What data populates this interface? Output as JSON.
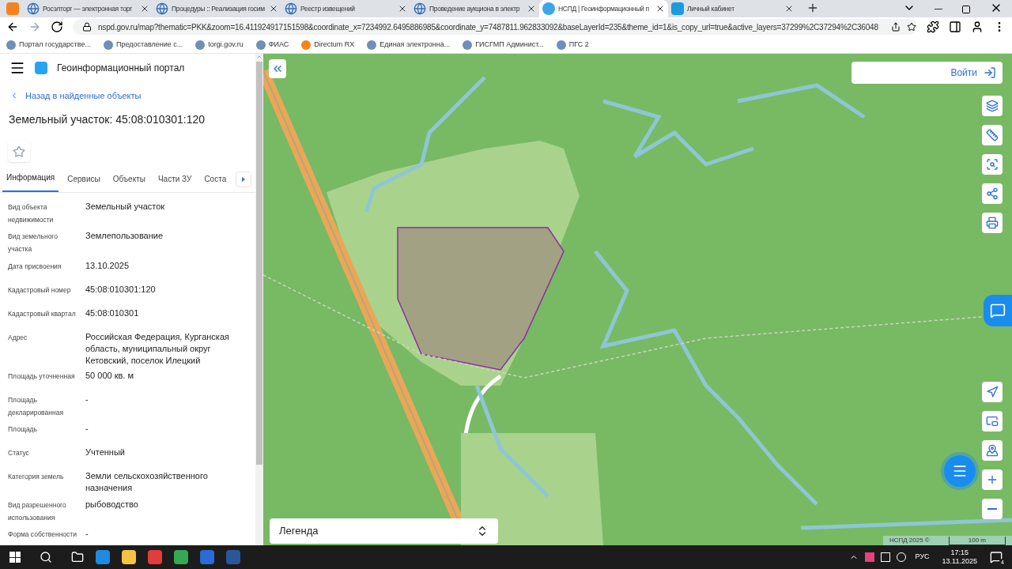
{
  "browser": {
    "tabs": [
      {
        "selected": false
      },
      {
        "title": "Росэлторг — электронная торг",
        "selected": false
      },
      {
        "title": "Процедуры :: Реализация госим",
        "selected": false
      },
      {
        "title": "Реестр извещений",
        "selected": false
      },
      {
        "title": "Проведение аукциона в электр",
        "selected": false
      },
      {
        "title": "НСПД | Геоинформационный п",
        "selected": true
      },
      {
        "title": "Личный кабинет",
        "selected": false
      }
    ],
    "address": "nspd.gov.ru/map?thematic=PKK&zoom=16.411924917151598&coordinate_x=7234992.6495886985&coordinate_y=7487811.962833092&baseLayerId=235&theme_id=1&is_copy_url=true&active_layers=37299%2C37294%2C36048",
    "bookmarks": [
      "Портал государстве...",
      "Предоставление с...",
      "torgi.gov.ru",
      "ФИАС",
      "Directum RX",
      "Единая электронна...",
      "ГИСГМП Админист...",
      "ПГС 2"
    ]
  },
  "sidebar": {
    "title": "Геоинформационный портал",
    "back_link": "Назад в найденные объекты",
    "heading": "Земельный участок: 45:08:010301:120",
    "tabs": [
      {
        "label": "Информация",
        "selected": true
      },
      {
        "label": "Сервисы",
        "selected": false
      },
      {
        "label": "Объекты",
        "selected": false
      },
      {
        "label": "Части ЗУ",
        "selected": false
      },
      {
        "label": "Соста",
        "selected": false
      }
    ],
    "fields": [
      {
        "label": "Вид объекта недвижимости",
        "value": "Земельный участок"
      },
      {
        "label": "Вид земельного участка",
        "value": "Землепользование"
      },
      {
        "label": "Дата присвоения",
        "value": "13.10.2025"
      },
      {
        "label": "Кадастровый номер",
        "value": "45:08:010301:120"
      },
      {
        "label": "Кадастровый квартал",
        "value": "45:08:010301"
      },
      {
        "label": "Адрес",
        "value": "Российская Федерация, Курганская область, муниципальный округ Кетовский, поселок Илецкий"
      },
      {
        "label": "Площадь уточненная",
        "value": "50 000 кв. м"
      },
      {
        "label": "Площадь декларированная",
        "value": "-"
      },
      {
        "label": "Площадь",
        "value": "-"
      },
      {
        "label": "Статус",
        "value": "Учтенный"
      },
      {
        "label": "Категория земель",
        "value": "Земли сельскохозяйственного назначения"
      },
      {
        "label": "Вид разрешенного использования",
        "value": "рыбоводство"
      },
      {
        "label": "Форма собственности",
        "value": "-"
      }
    ]
  },
  "map": {
    "login": "Войти",
    "legend": "Легенда",
    "attribution": "НСПД 2025 ©",
    "scale": "100 m"
  },
  "taskbar": {
    "language": "РУС",
    "time": "17:15",
    "date": "13.11.2025",
    "notifications": "4"
  }
}
